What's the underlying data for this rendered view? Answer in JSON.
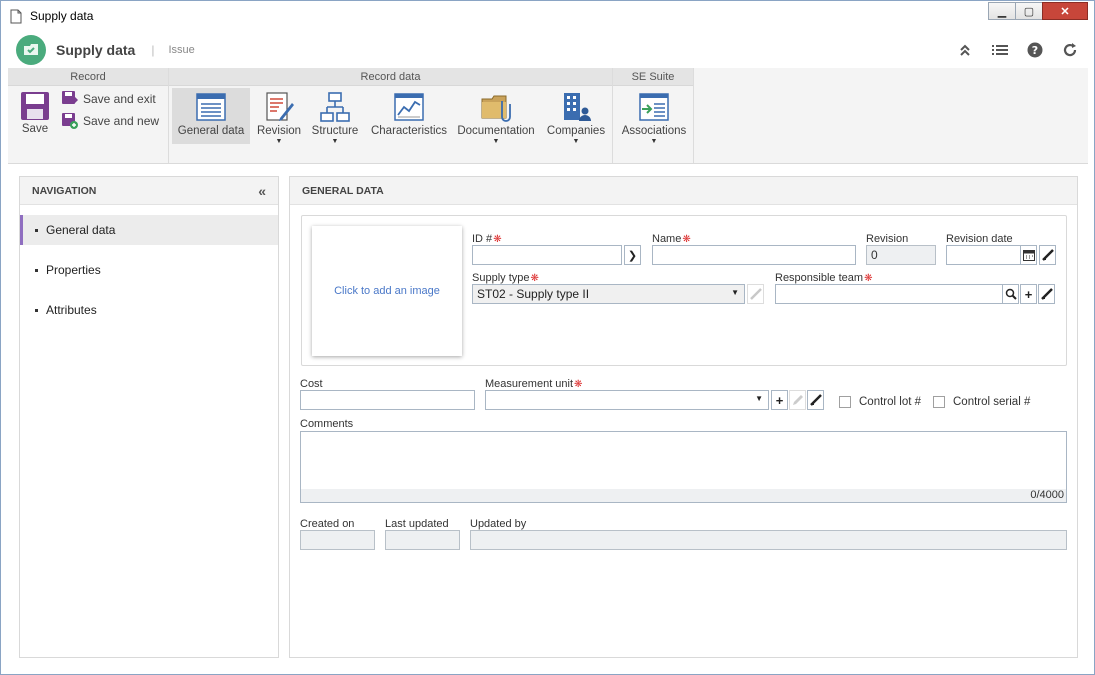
{
  "window": {
    "title": "Supply data",
    "buttons": [
      "minimize",
      "maximize",
      "close"
    ]
  },
  "header": {
    "app_title": "Supply data",
    "separator": "|",
    "subtitle": "Issue",
    "icons": [
      "collapse-up-icon",
      "list-icon",
      "help-icon",
      "refresh-icon"
    ]
  },
  "ribbon": {
    "groups": {
      "record": "Record",
      "record_data": "Record data",
      "se_suite": "SE Suite"
    },
    "save": "Save",
    "save_and_exit": "Save and exit",
    "save_and_new": "Save and new",
    "general_data": "General data",
    "revision": "Revision",
    "structure": "Structure",
    "characteristics": "Characteristics",
    "documentation": "Documentation",
    "companies": "Companies",
    "associations": "Associations"
  },
  "navigation": {
    "title": "NAVIGATION",
    "items": [
      {
        "label": "General data",
        "active": true
      },
      {
        "label": "Properties",
        "active": false
      },
      {
        "label": "Attributes",
        "active": false
      }
    ]
  },
  "main": {
    "title": "GENERAL DATA",
    "image_placeholder": "Click to add an image",
    "fields": {
      "id": {
        "label": "ID #",
        "value": ""
      },
      "name": {
        "label": "Name",
        "value": ""
      },
      "revision": {
        "label": "Revision",
        "value": "0"
      },
      "revision_date": {
        "label": "Revision date",
        "value": ""
      },
      "supply_type": {
        "label": "Supply type",
        "value": "ST02 - Supply type II"
      },
      "responsible_team": {
        "label": "Responsible team",
        "value": ""
      },
      "cost": {
        "label": "Cost",
        "value": ""
      },
      "measurement_unit": {
        "label": "Measurement unit",
        "value": ""
      },
      "control_lot": {
        "label": "Control lot #",
        "checked": false
      },
      "control_serial": {
        "label": "Control serial #",
        "checked": false
      },
      "comments": {
        "label": "Comments",
        "value": "",
        "counter": "0/4000"
      },
      "created_on": {
        "label": "Created on",
        "value": ""
      },
      "last_updated": {
        "label": "Last updated",
        "value": ""
      },
      "updated_by": {
        "label": "Updated by",
        "value": ""
      }
    }
  }
}
